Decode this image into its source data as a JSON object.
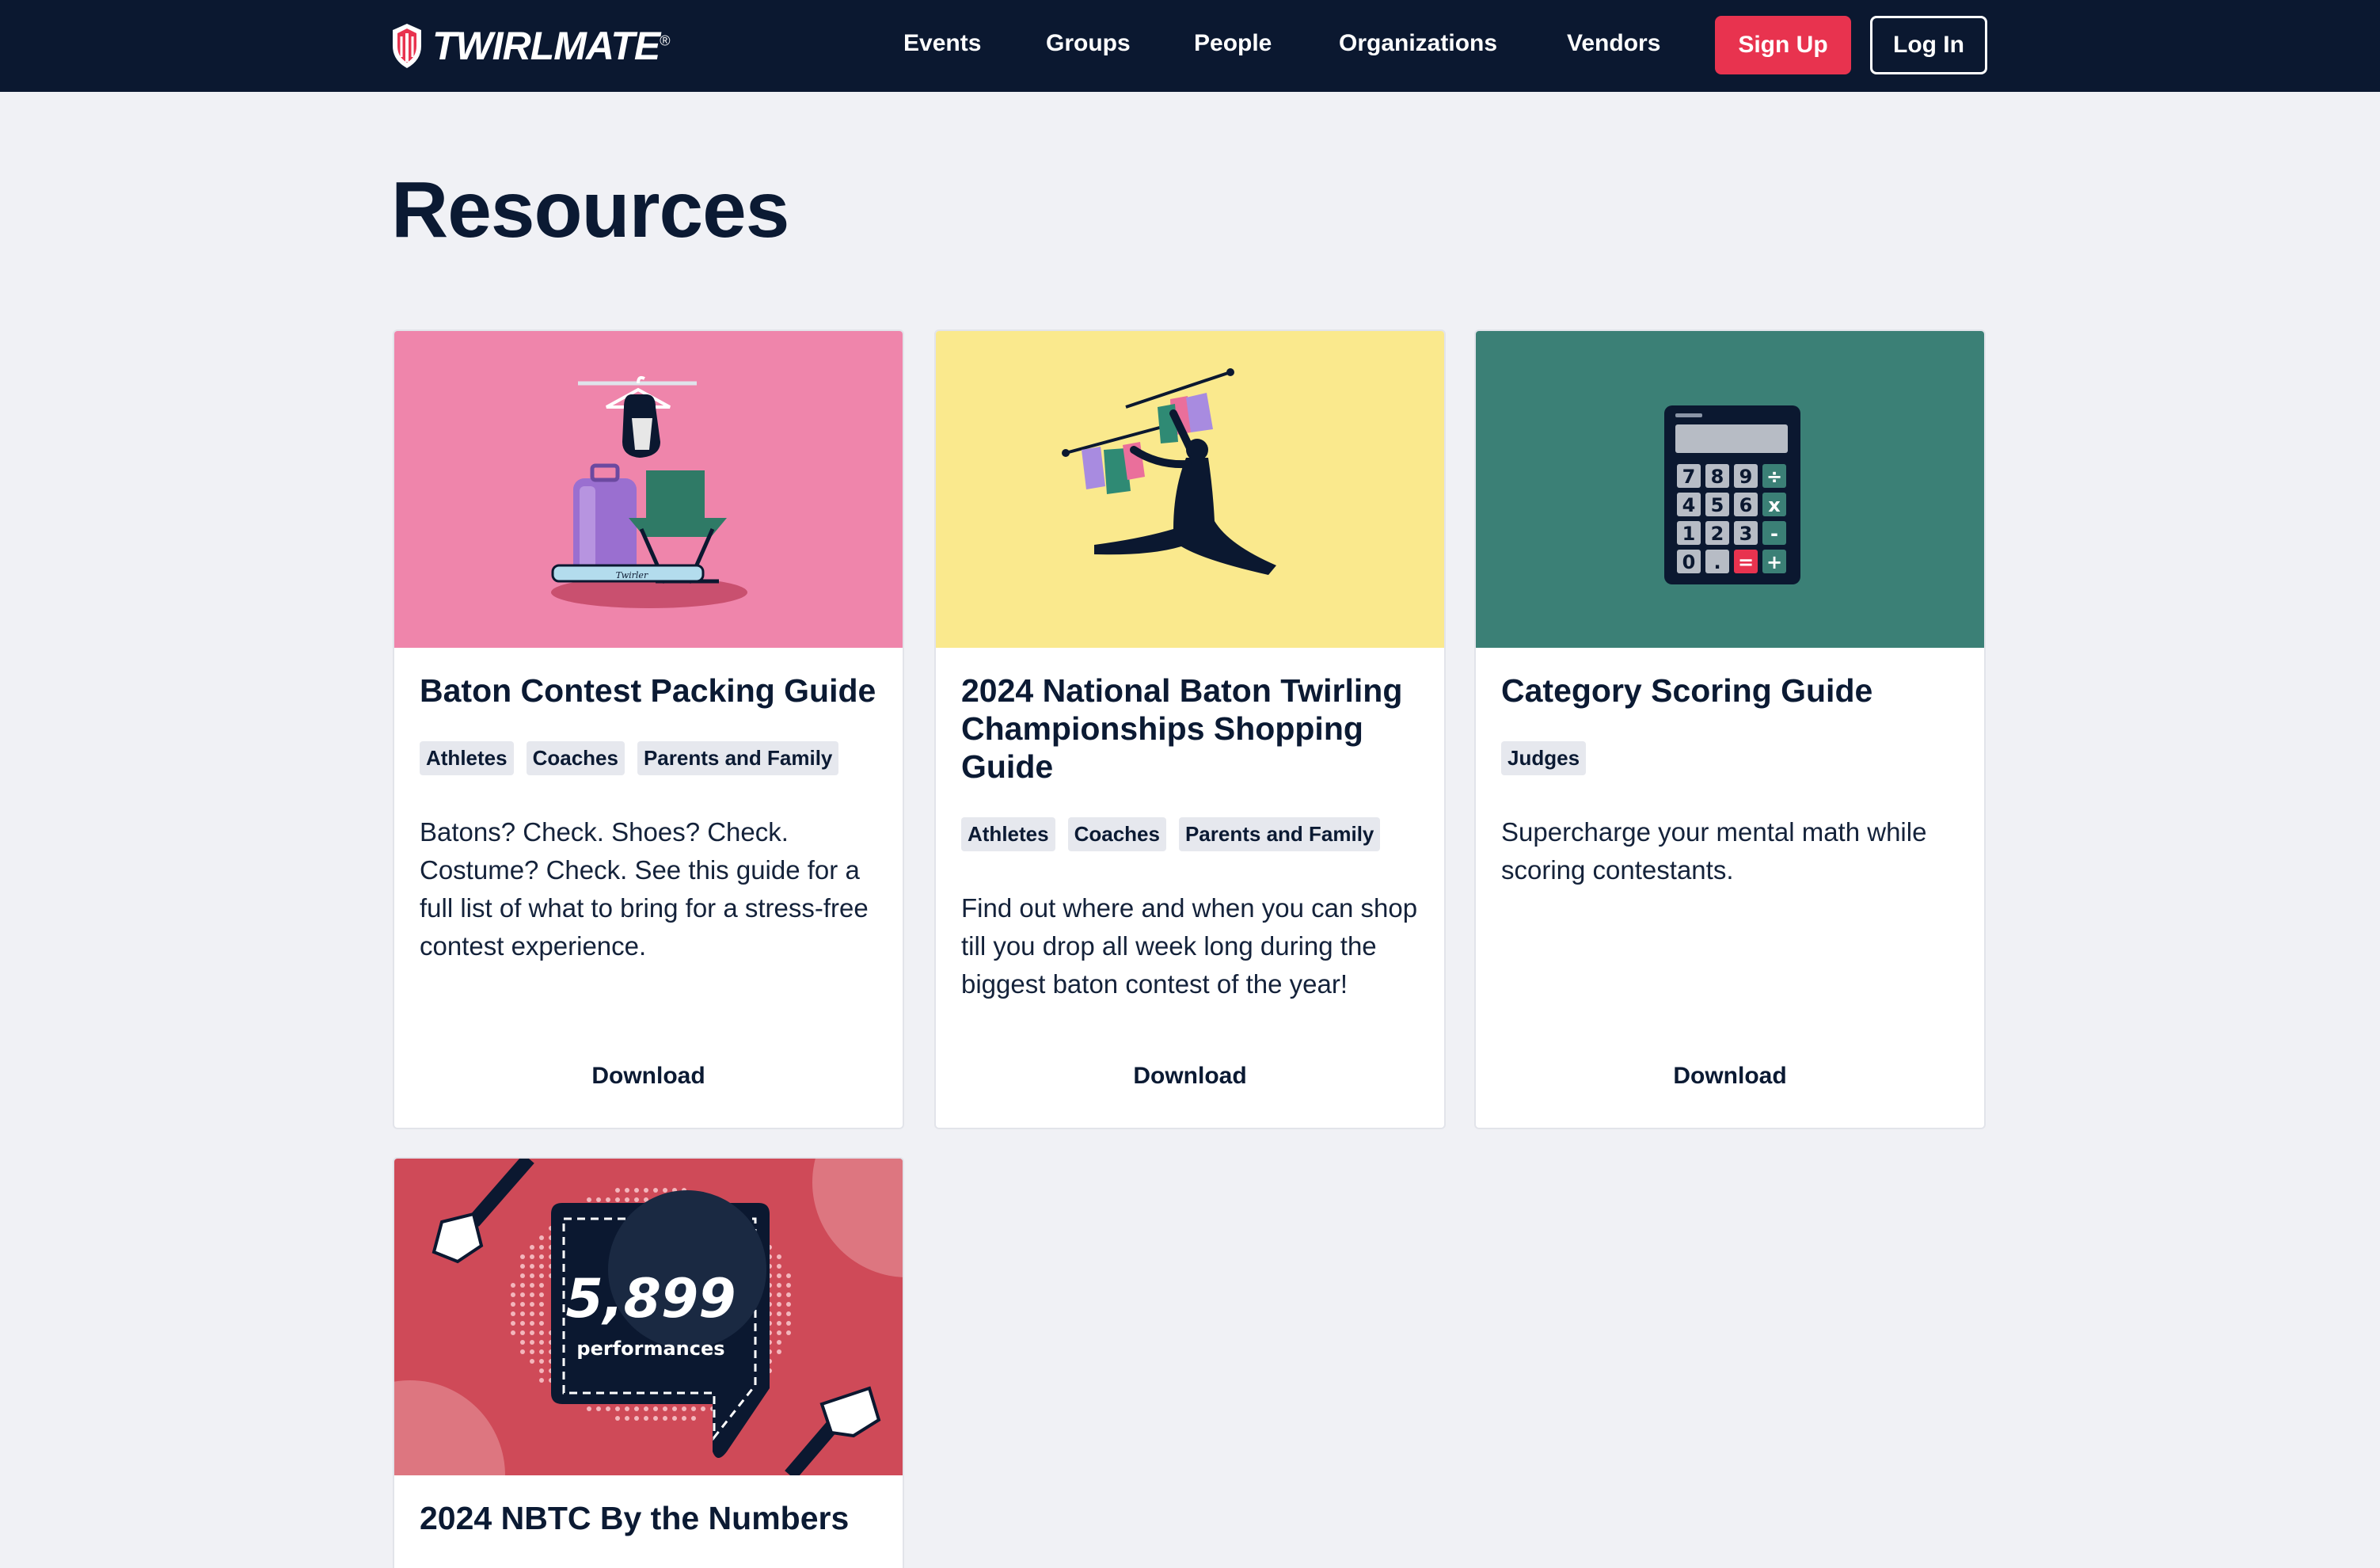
{
  "header": {
    "brand": "TWIRLMATE",
    "brand_mark": "®",
    "nav": [
      "Events",
      "Groups",
      "People",
      "Organizations",
      "Vendors"
    ],
    "signup_label": "Sign Up",
    "login_label": "Log In"
  },
  "page": {
    "title": "Resources"
  },
  "cards": [
    {
      "title": "Baton Contest Packing Guide",
      "tags": [
        "Athletes",
        "Coaches",
        "Parents and Family"
      ],
      "description": "Batons? Check. Shoes? Check. Costume? Check. See this guide for a full list of what to bring for a stress-free contest experience.",
      "download_label": "Download",
      "image_bg": "#ef85ab",
      "image_icon": "packing-illustration",
      "image_text": "Twirler"
    },
    {
      "title": "2024 National Baton Twirling Championships Shopping Guide",
      "tags": [
        "Athletes",
        "Coaches",
        "Parents and Family"
      ],
      "description": "Find out where and when you can shop till you drop all week long during the biggest baton contest of the year!",
      "download_label": "Download",
      "image_bg": "#fae98d",
      "image_icon": "shopping-twirler-illustration"
    },
    {
      "title": "Category Scoring Guide",
      "tags": [
        "Judges"
      ],
      "description": "Supercharge your mental math while scoring contestants.",
      "download_label": "Download",
      "image_bg": "#3b8076",
      "image_icon": "calculator-illustration",
      "calc_keys": [
        "7",
        "8",
        "9",
        "÷",
        "4",
        "5",
        "6",
        "x",
        "1",
        "2",
        "3",
        "-",
        "0",
        ".",
        "=",
        "+"
      ]
    },
    {
      "title": "2024 NBTC By the Numbers",
      "image_bg": "#cf4a58",
      "image_icon": "stats-bubble-illustration",
      "stat_value": "5,899",
      "stat_label": "performances"
    }
  ],
  "colors": {
    "header_bg": "#0b1830",
    "accent": "#e8334f",
    "page_bg": "#f0f1f5"
  }
}
